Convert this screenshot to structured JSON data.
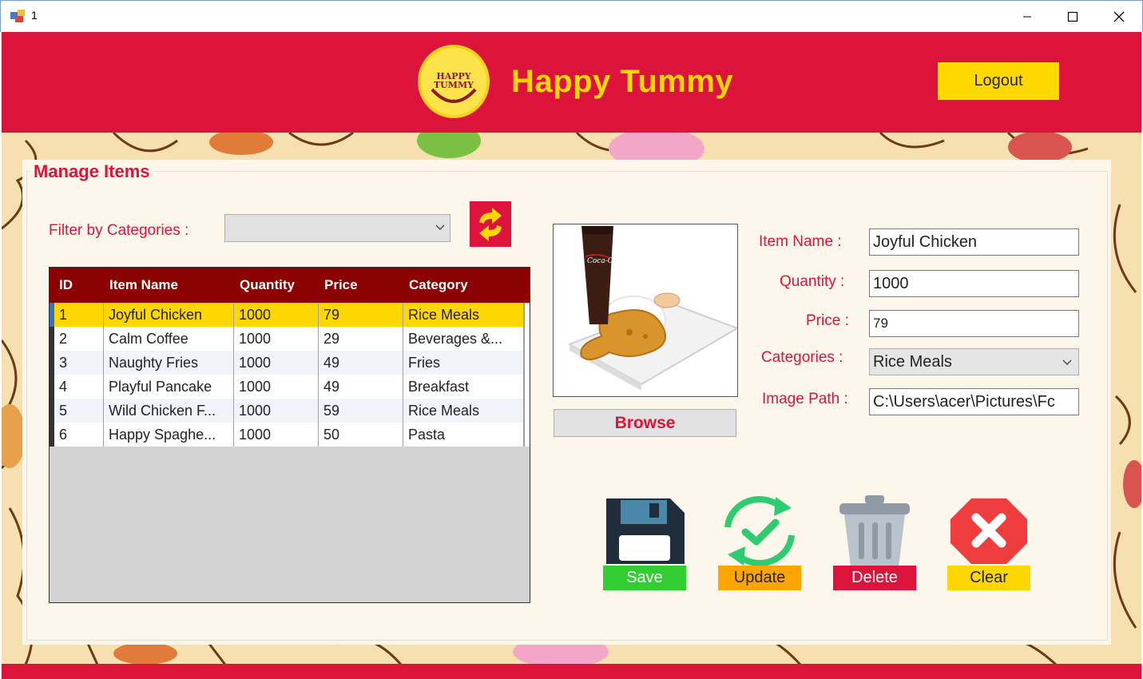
{
  "window": {
    "title": "1",
    "controls": [
      "minimize-icon",
      "maximize-icon",
      "close-icon"
    ]
  },
  "header": {
    "logo_text_top": "HAPPY",
    "logo_text_bottom": "TUMMY",
    "app_title": "Happy Tummy",
    "logout_label": "Logout"
  },
  "panel": {
    "group_title": "Manage Items",
    "filter_label": "Filter by Categories :",
    "filter_value": ""
  },
  "grid": {
    "columns": [
      "ID",
      "Item Name",
      "Quantity",
      "Price",
      "Category"
    ],
    "rows": [
      {
        "id": "1",
        "name": "Joyful Chicken",
        "qty": "1000",
        "price": "79",
        "category": "Rice Meals",
        "selected": true
      },
      {
        "id": "2",
        "name": "Calm Coffee",
        "qty": "1000",
        "price": "29",
        "category": "Beverages &...",
        "selected": false
      },
      {
        "id": "3",
        "name": "Naughty Fries",
        "qty": "1000",
        "price": "49",
        "category": "Fries",
        "selected": false
      },
      {
        "id": "4",
        "name": "Playful Pancake",
        "qty": "1000",
        "price": "49",
        "category": "Breakfast",
        "selected": false
      },
      {
        "id": "5",
        "name": "Wild Chicken F...",
        "qty": "1000",
        "price": "59",
        "category": "Rice Meals",
        "selected": false
      },
      {
        "id": "6",
        "name": "Happy Spaghe...",
        "qty": "1000",
        "price": "50",
        "category": "Pasta",
        "selected": false
      }
    ]
  },
  "image": {
    "browse_label": "Browse",
    "can_text": "Coca-Cola"
  },
  "form": {
    "item_name_label": "Item Name :",
    "item_name_value": "Joyful Chicken",
    "quantity_label": "Quantity :",
    "quantity_value": "1000",
    "price_label": "Price :",
    "price_value": "79",
    "categories_label": "Categories :",
    "categories_value": "Rice Meals",
    "image_path_label": "Image Path :",
    "image_path_value": "C:\\Users\\acer\\Pictures\\Fc"
  },
  "actions": {
    "save_label": "Save",
    "update_label": "Update",
    "delete_label": "Delete",
    "clear_label": "Clear"
  },
  "colors": {
    "brand_red": "#dc143c",
    "brand_yellow": "#ffd700",
    "grid_header": "#8b0000",
    "save_green": "#32cd32",
    "update_orange": "#ffa500",
    "delete_red": "#dc143c",
    "clear_yellow": "#ffd700"
  }
}
